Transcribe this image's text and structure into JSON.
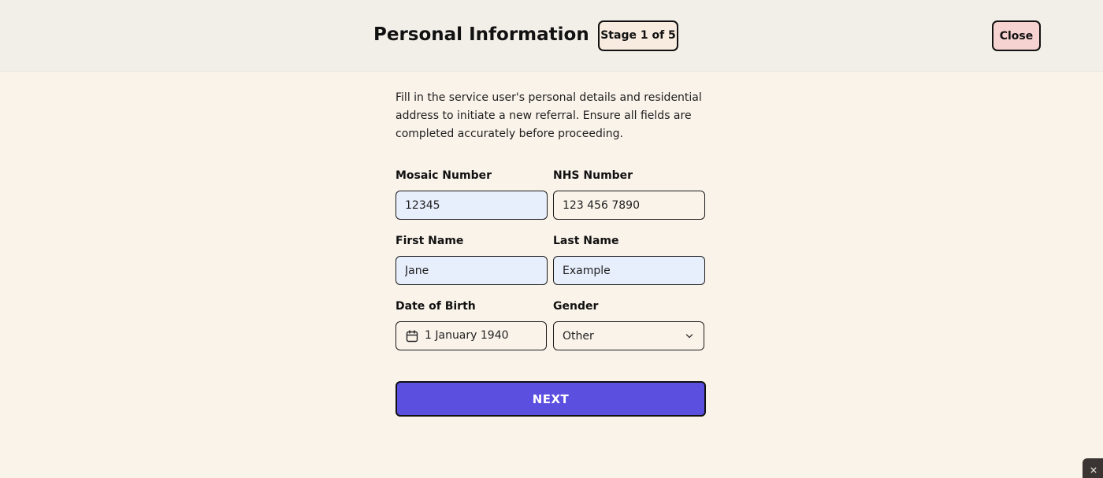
{
  "header": {
    "title": "Personal Information",
    "stage_label": "Stage 1 of 5",
    "close_label": "Close"
  },
  "intro_text": "Fill in the service user's personal details and residential address to initiate a new referral. Ensure all fields are completed accurately before proceeding.",
  "form": {
    "mosaic_number": {
      "label": "Mosaic Number",
      "value": "12345"
    },
    "nhs_number": {
      "label": "NHS Number",
      "value": "123 456 7890"
    },
    "first_name": {
      "label": "First Name",
      "value": "Jane"
    },
    "last_name": {
      "label": "Last Name",
      "value": "Example"
    },
    "date_of_birth": {
      "label": "Date of Birth",
      "value": "1 January 1940",
      "icon": "calendar-icon"
    },
    "gender": {
      "label": "Gender",
      "value": "Other",
      "icon": "chevron-down-icon"
    }
  },
  "next_label": "NEXT",
  "colors": {
    "page_background": "#faf3ea",
    "header_background": "#f2eee8",
    "stage_badge_background": "#f7ecdf",
    "close_button_background": "#f6d2d0",
    "filled_field_background": "#e7eefc",
    "primary_button": "#5b4fe0"
  }
}
